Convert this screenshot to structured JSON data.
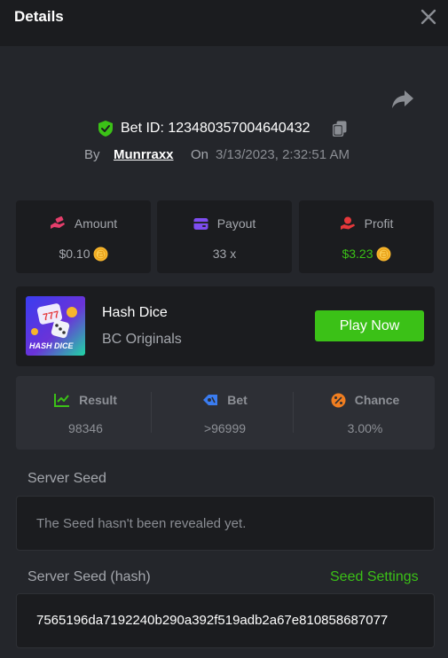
{
  "header": {
    "title": "Details"
  },
  "bet": {
    "id_text": "Bet ID: 123480357004640432",
    "by_label": "By",
    "username": "Munrraxx",
    "on_label": "On",
    "datetime": "3/13/2023, 2:32:51 AM"
  },
  "stats": {
    "amount": {
      "label": "Amount",
      "value": "$0.10"
    },
    "payout": {
      "label": "Payout",
      "value": "33 x"
    },
    "profit": {
      "label": "Profit",
      "value": "$3.23"
    }
  },
  "game": {
    "thumb_text": "HASH DICE",
    "name": "Hash Dice",
    "provider": "BC Originals",
    "play_label": "Play Now"
  },
  "results": {
    "result": {
      "label": "Result",
      "value": "98346"
    },
    "bet": {
      "label": "Bet",
      "value": ">96999"
    },
    "chance": {
      "label": "Chance",
      "value": "3.00%"
    }
  },
  "server_seed": {
    "label": "Server Seed",
    "text": "The Seed hasn't been revealed yet."
  },
  "server_seed_hash": {
    "label": "Server Seed (hash)",
    "settings_label": "Seed Settings",
    "value": "7565196da7192240b290a392f519adb2a67e810858687077"
  },
  "colors": {
    "accent_green": "#3bc117",
    "profit_green": "#3bc117",
    "background": "#24262b",
    "panel": "#1b1c1f"
  },
  "icons": {
    "close": "close-icon",
    "share": "share-icon",
    "shield": "shield-check-icon",
    "copy": "copy-icon",
    "amount": "hand-money-icon",
    "payout": "wallet-icon",
    "profit": "profit-hand-icon",
    "coin": "coin-icon",
    "result": "chart-check-icon",
    "bet": "ticket-icon",
    "chance": "percent-icon"
  }
}
